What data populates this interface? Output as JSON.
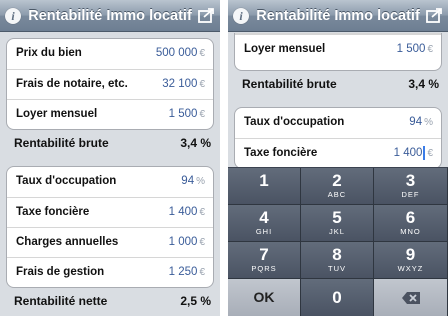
{
  "app": {
    "title": "Rentabilité Immo locatif"
  },
  "left": {
    "group1": [
      {
        "label": "Prix du bien",
        "value": "500 000",
        "unit": "€"
      },
      {
        "label": "Frais de notaire, etc.",
        "value": "32 100",
        "unit": "€"
      },
      {
        "label": "Loyer mensuel",
        "value": "1 500",
        "unit": "€"
      }
    ],
    "brute": {
      "label": "Rentabilité brute",
      "value": "3,4 %"
    },
    "group2": [
      {
        "label": "Taux d'occupation",
        "value": "94",
        "unit": "%"
      },
      {
        "label": "Taxe foncière",
        "value": "1 400",
        "unit": "€"
      },
      {
        "label": "Charges annuelles",
        "value": "1 000",
        "unit": "€"
      },
      {
        "label": "Frais de gestion",
        "value": "1 250",
        "unit": "€"
      }
    ],
    "nette": {
      "label": "Rentabilité nette",
      "value": "2,5 %"
    }
  },
  "right": {
    "group1": [
      {
        "label": "Loyer mensuel",
        "value": "1 500",
        "unit": "€"
      }
    ],
    "brute": {
      "label": "Rentabilité brute",
      "value": "3,4 %"
    },
    "group2": [
      {
        "label": "Taux d'occupation",
        "value": "94",
        "unit": "%"
      },
      {
        "label": "Taxe foncière",
        "value": "1 400",
        "unit": "€"
      }
    ]
  },
  "keypad": {
    "keys": [
      {
        "digit": "1",
        "letters": ""
      },
      {
        "digit": "2",
        "letters": "ABC"
      },
      {
        "digit": "3",
        "letters": "DEF"
      },
      {
        "digit": "4",
        "letters": "GHI"
      },
      {
        "digit": "5",
        "letters": "JKL"
      },
      {
        "digit": "6",
        "letters": "MNO"
      },
      {
        "digit": "7",
        "letters": "PQRS"
      },
      {
        "digit": "8",
        "letters": "TUV"
      },
      {
        "digit": "9",
        "letters": "WXYZ"
      }
    ],
    "ok_label": "OK",
    "zero": "0"
  },
  "icons": {
    "info": "info-icon",
    "share": "share-icon",
    "delete": "backspace-icon"
  }
}
